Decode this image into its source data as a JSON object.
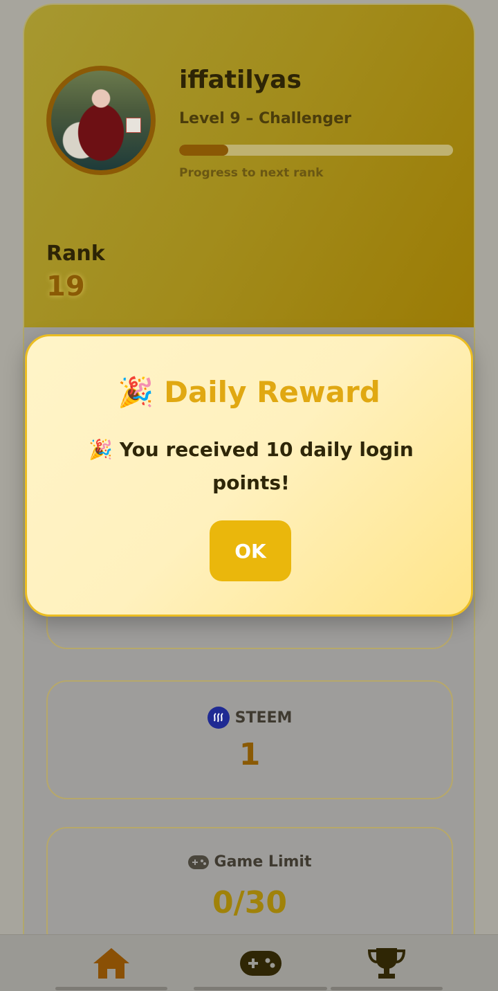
{
  "profile": {
    "username": "iffatilyas",
    "level_text": "Level 9 – Challenger",
    "progress_fraction": 0.18,
    "progress_label": "Progress to next rank",
    "rank_label": "Rank",
    "rank_value": "19"
  },
  "stats": {
    "steem": {
      "label": "STEEM",
      "value": "1",
      "icon": "steem-icon"
    },
    "game_limit": {
      "label": "Game Limit",
      "value": "0/30",
      "icon": "gamepad-icon"
    }
  },
  "dialog": {
    "icon": "🎉",
    "title": "Daily Reward",
    "message_icon": "🎉",
    "message": "You received 10 daily login points!",
    "ok_label": "OK"
  },
  "nav": {
    "items": [
      {
        "icon": "home-icon"
      },
      {
        "icon": "gamepad-icon"
      },
      {
        "icon": "trophy-icon"
      }
    ]
  },
  "colors": {
    "accent": "#eab70c",
    "header_gold": "#a28c1c",
    "rank_brown": "#8a5a05"
  }
}
